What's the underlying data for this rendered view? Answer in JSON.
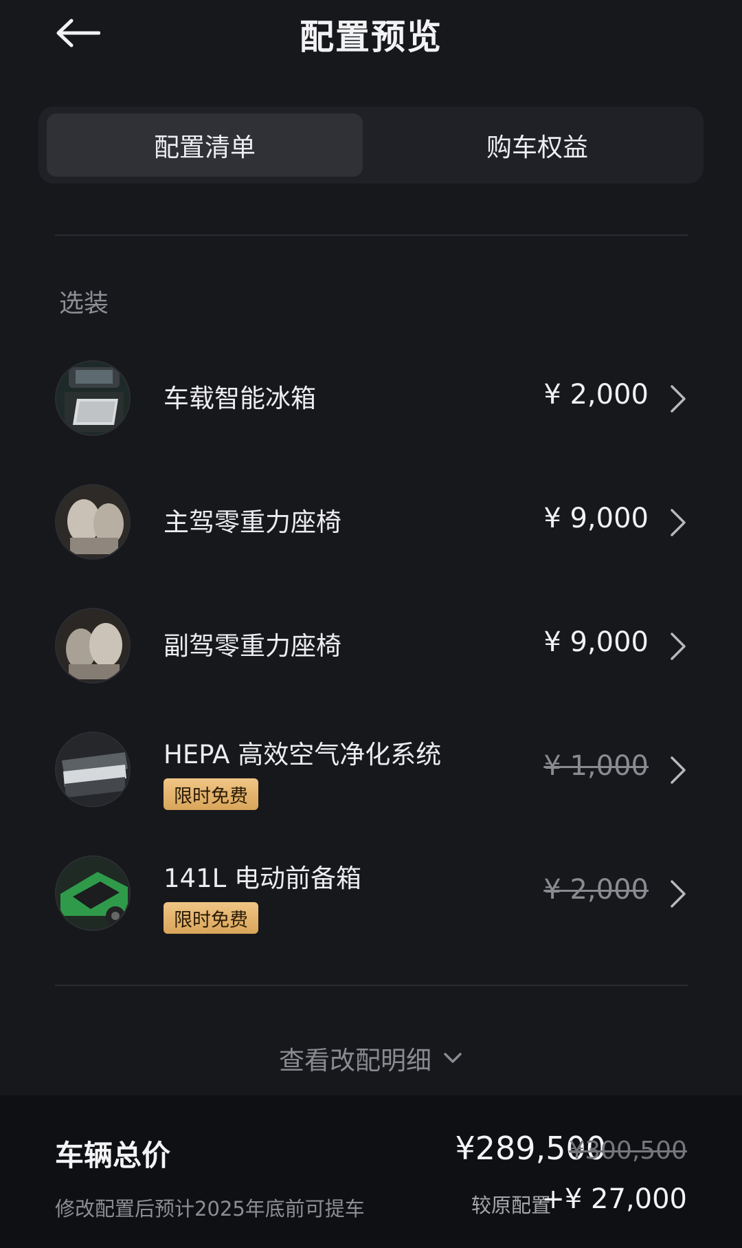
{
  "header": {
    "title": "配置预览",
    "back_icon": "arrow-left-icon"
  },
  "tabs": [
    {
      "label": "配置清单",
      "active": true
    },
    {
      "label": "购车权益",
      "active": false
    }
  ],
  "section": {
    "label": "选装"
  },
  "options": [
    {
      "name": "车载智能冰箱",
      "price": "¥ 2,000",
      "struck": false,
      "badge": "",
      "thumb": "fridge-thumbnail"
    },
    {
      "name": "主驾零重力座椅",
      "price": "¥ 9,000",
      "struck": false,
      "badge": "",
      "thumb": "driver-seat-thumbnail"
    },
    {
      "name": "副驾零重力座椅",
      "price": "¥ 9,000",
      "struck": false,
      "badge": "",
      "thumb": "passenger-seat-thumbnail"
    },
    {
      "name": "HEPA 高效空气净化系统",
      "price": "¥ 1,000",
      "struck": true,
      "badge": "限时免费",
      "thumb": "hepa-filter-thumbnail"
    },
    {
      "name": "141L 电动前备箱",
      "price": "¥ 2,000",
      "struck": true,
      "badge": "限时免费",
      "thumb": "frunk-thumbnail"
    }
  ],
  "view_details": {
    "label": "查看改配明细",
    "icon": "chevron-down-icon"
  },
  "footer": {
    "total_label": "车辆总价",
    "total_price": "¥289,500",
    "original_price": "¥300,500",
    "delivery_note": "修改配置后预计2025年底前可提车",
    "diff_label": "较原配置",
    "diff_value": "+¥ 27,000"
  },
  "colors": {
    "background": "#17181c",
    "badge_gold": "#e3b26c",
    "footer_bg": "#0f1013"
  }
}
